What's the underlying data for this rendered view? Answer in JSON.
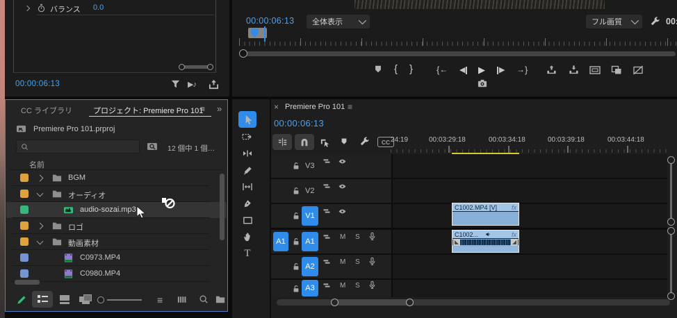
{
  "effect_controls": {
    "param_name": "バランス",
    "param_value": "0.0",
    "timecode": "00:00:06:13"
  },
  "project": {
    "tab_cc": "CC ライブラリ",
    "tab_active": "プロジェクト: Premiere Pro 101",
    "file_name": "Premiere Pro 101.prproj",
    "search_value": "",
    "count": "12 個中 1 個…",
    "col_name": "名前",
    "items": [
      {
        "name": "BGM",
        "type": "folder",
        "label_color": "orange"
      },
      {
        "name": "オーディオ",
        "type": "folder",
        "label_color": "orange"
      },
      {
        "name": "audio-sozai.mp3",
        "type": "audio",
        "label_color": "green"
      },
      {
        "name": "ロゴ",
        "type": "folder",
        "label_color": "orange"
      },
      {
        "name": "動画素材",
        "type": "folder",
        "label_color": "orange"
      },
      {
        "name": "C0973.MP4",
        "type": "video",
        "label_color": "blue"
      },
      {
        "name": "C0980.MP4",
        "type": "video",
        "label_color": "blue"
      }
    ]
  },
  "monitor": {
    "timecode": "00:00:06:13",
    "zoom": "全体表示",
    "quality": "フル画質",
    "duration": "00:"
  },
  "timeline": {
    "tab": "Premiere Pro 101",
    "timecode": "00:00:06:13",
    "ruler": [
      "24:19",
      "00:03:29:18",
      "00:03:34:18",
      "00:03:39:18",
      "00:03:44:18"
    ],
    "v3": "V3",
    "v2": "V2",
    "v1": "V1",
    "a1": "A1",
    "a2": "A2",
    "a3": "A3",
    "patch_a1": "A1",
    "mute": "M",
    "solo": "S",
    "cc": "CC",
    "fx": "fx",
    "clip_video": "C1002.MP4 [V]",
    "clip_audio": "C1002..."
  },
  "glyphs": {
    "close": "×",
    "menu": "≡",
    "more": "»",
    "play": "▶",
    "tri_left": "◀",
    "tri_right": "▶",
    "brace_in": "{",
    "brace_out": "}",
    "arrow_left": "←",
    "arrow_right": "→",
    "note": "♪",
    "play_note": "▶♪",
    "type_tool": "T",
    "sort": "≡"
  },
  "colors": {
    "accent_blue": "#2f8ceb",
    "timecode_blue": "#47a3f5",
    "label_orange": "#e0a33c",
    "label_green": "#35b87a",
    "label_blue": "#7494d2",
    "clip_fill": "#87b0d8",
    "ruler_highlight": "#d8ca28",
    "panel_focus_border": "#4a7fc1"
  }
}
